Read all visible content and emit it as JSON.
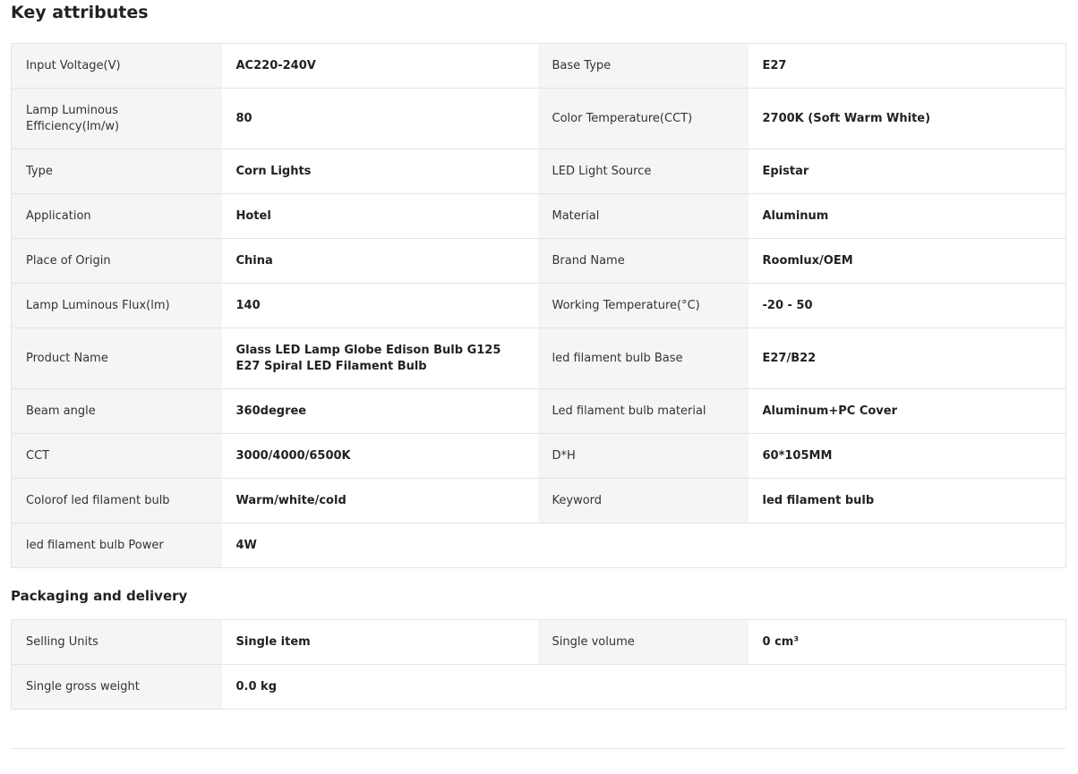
{
  "key_attributes": {
    "title": "Key attributes",
    "rows": [
      {
        "h": 51,
        "k1": "Input Voltage(V)",
        "v1": "AC220-240V",
        "k2": "Base Type",
        "v2": "E27"
      },
      {
        "h": 69,
        "k1": "Lamp Luminous Efficiency(lm/w)",
        "v1": "80",
        "k2": "Color Temperature(CCT)",
        "v2": "2700K (Soft Warm White)"
      },
      {
        "h": 51,
        "k1": "Type",
        "v1": "Corn Lights",
        "k2": "LED Light Source",
        "v2": "Epistar"
      },
      {
        "h": 51,
        "k1": "Application",
        "v1": "Hotel",
        "k2": "Material",
        "v2": "Aluminum"
      },
      {
        "h": 51,
        "k1": "Place of Origin",
        "v1": "China",
        "k2": "Brand Name",
        "v2": "Roomlux/OEM"
      },
      {
        "h": 51,
        "k1": "Lamp Luminous Flux(lm)",
        "v1": "140",
        "k2": "Working Temperature(°C)",
        "v2": "-20 - 50"
      },
      {
        "h": 69,
        "k1": "Product Name",
        "v1": "Glass LED Lamp Globe Edison Bulb G125 E27 Spiral LED Filament Bulb",
        "k2": "led filament bulb Base",
        "v2": "E27/B22"
      },
      {
        "h": 51,
        "k1": "Beam angle",
        "v1": "360degree",
        "k2": "Led filament bulb material",
        "v2": "Aluminum+PC Cover"
      },
      {
        "h": 51,
        "k1": "CCT",
        "v1": "3000/4000/6500K",
        "k2": "D*H",
        "v2": "60*105MM"
      },
      {
        "h": 51,
        "k1": "Colorof led filament bulb",
        "v1": "Warm/white/cold",
        "k2": "Keyword",
        "v2": "led filament bulb"
      },
      {
        "h": 51,
        "k1": "led filament bulb Power",
        "v1": "4W",
        "k2": "",
        "v2": ""
      }
    ]
  },
  "packaging": {
    "title": "Packaging and delivery",
    "rows": [
      {
        "h": 51,
        "k1": "Selling Units",
        "v1": "Single item",
        "k2": "Single volume",
        "v2": "0 cm³"
      },
      {
        "h": 51,
        "k1": "Single gross weight",
        "v1": "0.0 kg",
        "k2": "",
        "v2": ""
      }
    ]
  },
  "colors": {
    "key_cell_bg": "#f5f5f5",
    "border": "#e4e4e4",
    "text": "#222222"
  }
}
